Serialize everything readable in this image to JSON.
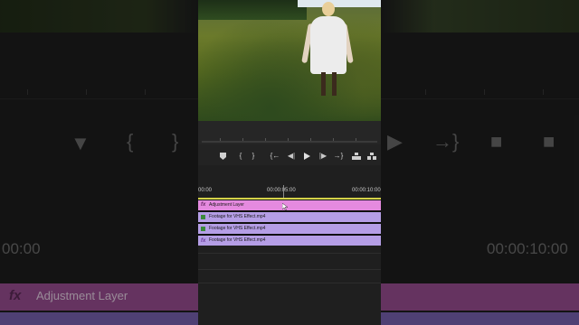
{
  "timeline": {
    "ruler": {
      "start": "00:00",
      "mid": "00:00:05:00",
      "end": "00:00:10:00"
    },
    "tracks": [
      {
        "badge": "fx",
        "label": "Adjustment Layer",
        "kind": "adjustment"
      },
      {
        "badge": "",
        "label": "Footage for VHS Effect.mp4",
        "kind": "clip"
      },
      {
        "badge": "",
        "label": "Footage for VHS Effect.mp4",
        "kind": "clip"
      },
      {
        "badge": "fx",
        "label": "Footage for VHS Effect.mp4",
        "kind": "clip-fx"
      }
    ]
  },
  "background": {
    "timecode_left": "00:00",
    "timecode_right": "00:00:10:00",
    "adjustment_badge": "fx",
    "adjustment_label": "Adjustment Layer"
  },
  "transport_icons": [
    "marker-icon",
    "mark-in-icon",
    "mark-out-icon",
    "go-to-in-icon",
    "step-back-icon",
    "play-icon",
    "step-forward-icon",
    "go-to-out-icon",
    "lift-icon",
    "extract-icon"
  ],
  "colors": {
    "adjustment": "#e58adf",
    "clip": "#b59ee6",
    "work_area": "#d6d24a"
  }
}
